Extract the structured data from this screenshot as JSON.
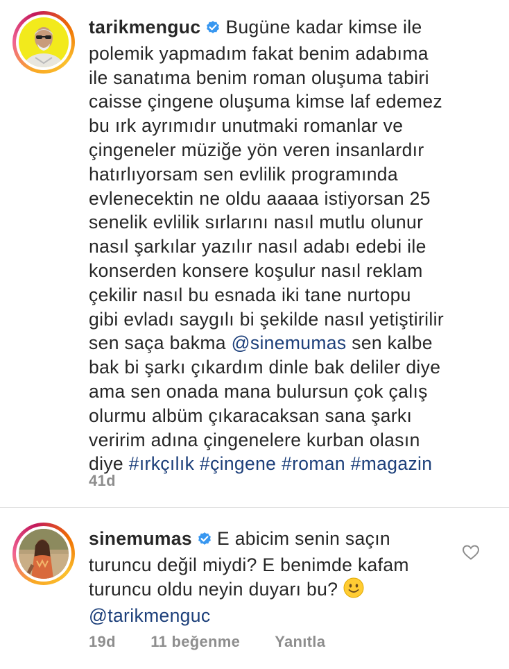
{
  "comments": [
    {
      "username": "tarikmenguc",
      "lines": [
        "Bugüne kadar kimse ile",
        "polemik yapmadım fakat benim adabıma",
        "ile sanatıma benim roman oluşuma tabiri",
        "caisse çingene oluşuma kimse laf edemez",
        "bu ırk ayrımıdır unutmaki romanlar ve",
        "çingeneler müziğe yön veren insanlardır",
        "hatırlıyorsam sen evlilik programında",
        "evlenecektin ne oldu aaaaa istiyorsan 25",
        "senelik evlilik sırlarını nasıl mutlu olunur",
        "nasıl şarkılar yazılır nasıl adabı edebi ile",
        "konserden konsere koşulur nasıl reklam",
        "çekilir nasıl bu esnada iki tane nurtopu",
        "gibi evladı saygılı bi şekilde nasıl yetiştirilir"
      ],
      "mention_line": {
        "before": "sen saça bakma ",
        "mention": "@sinemumas",
        "after": " sen kalbe"
      },
      "lines_after": [
        "bak bi şarkı çıkardım dinle bak deliler diye",
        "ama sen onada mana bulursun çok çalış",
        "olurmu albüm çıkaracaksan sana şarkı",
        "veririm adına çingenelere kurban olasın"
      ],
      "last_line_prefix": "diye ",
      "hashtags": [
        "#ırkçılık",
        "#çingene",
        "#roman",
        "#magazin"
      ],
      "time": "41d"
    },
    {
      "username": "sinemumas",
      "first_line": "E abicim senin saçın",
      "lines": [
        "turuncu değil miydi? E benimde kafam",
        "turuncu oldu neyin duyarı bu?"
      ],
      "emoji": "slightly-smiling-face-emoji",
      "mention": "@tarikmenguc",
      "time": "19d",
      "likes": "11 beğenme",
      "reply_label": "Yanıtla"
    }
  ],
  "colors": {
    "text": "#262626",
    "link": "#1c3f7a",
    "meta": "#8e8e8e",
    "verified": "#3897f0"
  }
}
